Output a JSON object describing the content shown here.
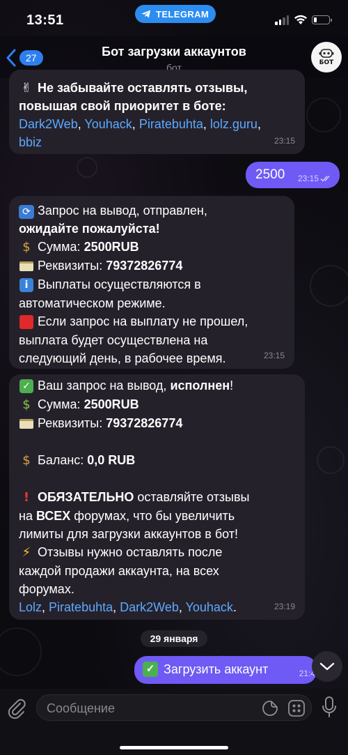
{
  "status_bar": {
    "time": "13:51",
    "app_pill": "TELEGRAM",
    "battery_level": 0.2
  },
  "header": {
    "back_count": "27",
    "title": "Бот загрузки аккаунтов",
    "subtitle": "бот",
    "avatar_text": "БОТ"
  },
  "messages": {
    "m1": {
      "line1": "Не забывайте оставлять отзывы,",
      "line2": "повышая свой приоритет в боте:",
      "link1": "Dark2Web",
      "link2": "Youhack",
      "link3": "Piratebuhta",
      "link4": "lolz.guru",
      "link5": "bbiz",
      "time": "23:15"
    },
    "out1": {
      "text": "2500",
      "time": "23:15"
    },
    "m2": {
      "l1": "Запрос на вывод,  отправлен,",
      "l2": "ожидайте пожалуйста!",
      "l3a": "Сумма: ",
      "l3b": "2500RUB",
      "l4a": "Реквизиты: ",
      "l4b": "79372826774",
      "l5": "Выплаты осуществляются в",
      "l6": "автоматическом режиме.",
      "l7": "Если запрос на выплату не прошел,",
      "l8": "выплата будет осуществлена на",
      "l9": "следующий день, в рабочее время.",
      "time": "23:15"
    },
    "m3": {
      "l1a": "Ваш запрос на вывод, ",
      "l1b": "исполнен",
      "l1c": "!",
      "l2a": "Сумма: ",
      "l2b": "2500RUB",
      "l3a": "Реквизиты: ",
      "l3b": "79372826774",
      "l4a": "Баланс: ",
      "l4b": "0,0 RUB",
      "l5a": "ОБЯЗАТЕЛЬНО",
      "l5b": " оставляйте отзывы",
      "l6a": "на ",
      "l6b": "ВСЕХ",
      "l6c": " форумах, что бы увеличить",
      "l7": "лимиты для загрузки аккаунтов в бот!",
      "l8": "Отзывы нужно оставлять после",
      "l9": "каждой продажи аккаунта, на всех",
      "l10": "форумах.",
      "link1": "Lolz",
      "link2": "Piratebuhta",
      "link3": "Dark2Web",
      "link4": "Youhack",
      "time": "23:19"
    },
    "date_divider": "29 января",
    "out2": {
      "text": "Загрузить аккаунт",
      "time": "21:4"
    }
  },
  "input": {
    "placeholder": "Сообщение"
  },
  "colors": {
    "accent": "#2d7ff0",
    "outgoing": "#6f5af5",
    "incoming": "#25212b",
    "link": "#5da9ff"
  },
  "icons": [
    "telegram-icon",
    "back-chevron-icon",
    "bot-avatar-icon",
    "attach-icon",
    "sticker-icon",
    "bot-commands-icon",
    "mic-icon",
    "chevron-down-icon"
  ]
}
